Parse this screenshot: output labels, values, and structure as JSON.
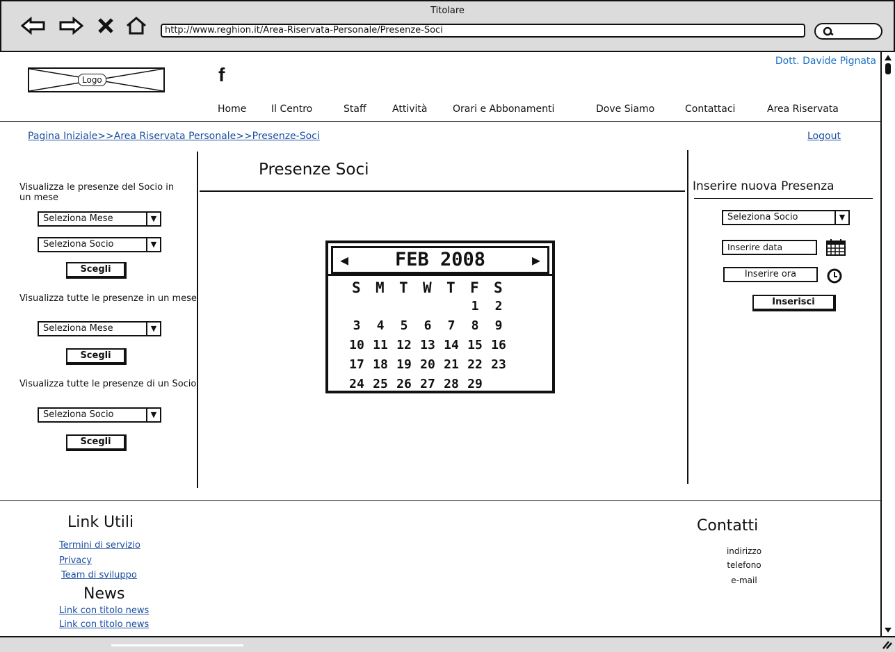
{
  "browser": {
    "title": "Titolare",
    "url": "http://www.reghion.it/Area-Riservata-Personale/Presenze-Soci"
  },
  "header": {
    "logo": "Logo",
    "user": "Dott. Davide Pignata",
    "facebook": "f",
    "nav": [
      "Home",
      "Il Centro",
      "Staff",
      "Attività",
      "Orari e Abbonamenti",
      "Dove Siamo",
      "Contattaci",
      "Area Riservata"
    ]
  },
  "breadcrumb": "Pagina Iniziale>>Area Riservata Personale>>Presenze-Soci",
  "logout": "Logout",
  "left": {
    "sec1_text": "Visualizza le presenze del Socio in un mese",
    "sec1_select_month": "Seleziona Mese",
    "sec1_select_member": "Seleziona Socio",
    "sec1_button": "Scegli",
    "sec2_text": "Visualizza tutte le presenze in un mese",
    "sec2_select_month": "Seleziona Mese",
    "sec2_button": "Scegli",
    "sec3_text": "Visualizza tutte le presenze di un Socio",
    "sec3_select_member": "Seleziona Socio",
    "sec3_button": "Scegli"
  },
  "main": {
    "title": "Presenze Soci",
    "calendar": {
      "month_label": "FEB 2008",
      "weekdays": [
        "S",
        "M",
        "T",
        "W",
        "T",
        "F",
        "S"
      ],
      "weeks": [
        [
          "",
          "",
          "",
          "",
          "",
          "1",
          "2"
        ],
        [
          "3",
          "4",
          "5",
          "6",
          "7",
          "8",
          "9"
        ],
        [
          "10",
          "11",
          "12",
          "13",
          "14",
          "15",
          "16"
        ],
        [
          "17",
          "18",
          "19",
          "20",
          "21",
          "22",
          "23"
        ],
        [
          "24",
          "25",
          "26",
          "27",
          "28",
          "29",
          ""
        ]
      ]
    }
  },
  "right": {
    "title": "Inserire nuova Presenza",
    "select_member": "Seleziona Socio",
    "date_input": "Inserire data",
    "time_input": "Inserire ora",
    "button": "Inserisci"
  },
  "footer": {
    "links_title": "Link Utili",
    "links": [
      "Termini di servizio",
      "Privacy",
      "Team di sviluppo"
    ],
    "news_title": "News",
    "news": [
      "Link con titolo news",
      "Link con titolo news"
    ],
    "contacts_title": "Contatti",
    "contacts": [
      "indirizzo",
      "telefono",
      "e-mail"
    ]
  }
}
